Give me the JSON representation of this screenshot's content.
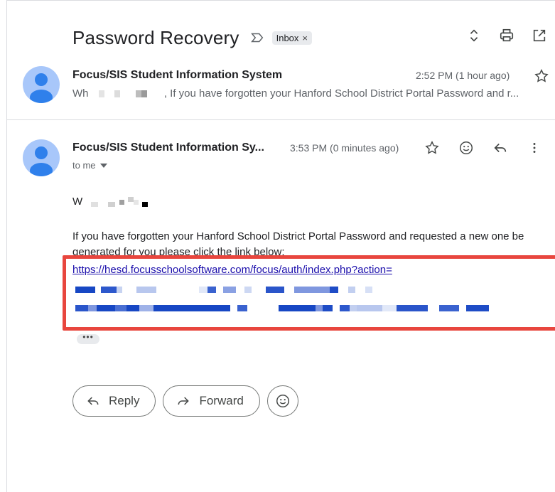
{
  "thread": {
    "subject": "Password Recovery",
    "label": "Inbox",
    "label_remove": "×"
  },
  "message1": {
    "sender": "Focus/SIS Student Information System",
    "time": "2:52 PM (1 hour ago)",
    "snippet_start": "Wh",
    "snippet_text": ", If you have forgotten your Hanford School District Portal Password and r..."
  },
  "message2": {
    "sender": "Focus/SIS Student Information Sy...",
    "time": "3:53 PM (0 minutes ago)",
    "to": "to me",
    "greeting": "W",
    "body": "If you have forgotten your Hanford School District Portal Password and requested a new one be generated for you please click the link below:",
    "link": "https://hesd.focusschoolsoftware.com/focus/auth/index.php?action=",
    "more": "•••"
  },
  "reply_bar": {
    "reply_label": "Reply",
    "forward_label": "Forward"
  },
  "colors": {
    "highlight": "#e8463e",
    "link": "#1a0dab",
    "avatar": "#a8c7fa"
  }
}
